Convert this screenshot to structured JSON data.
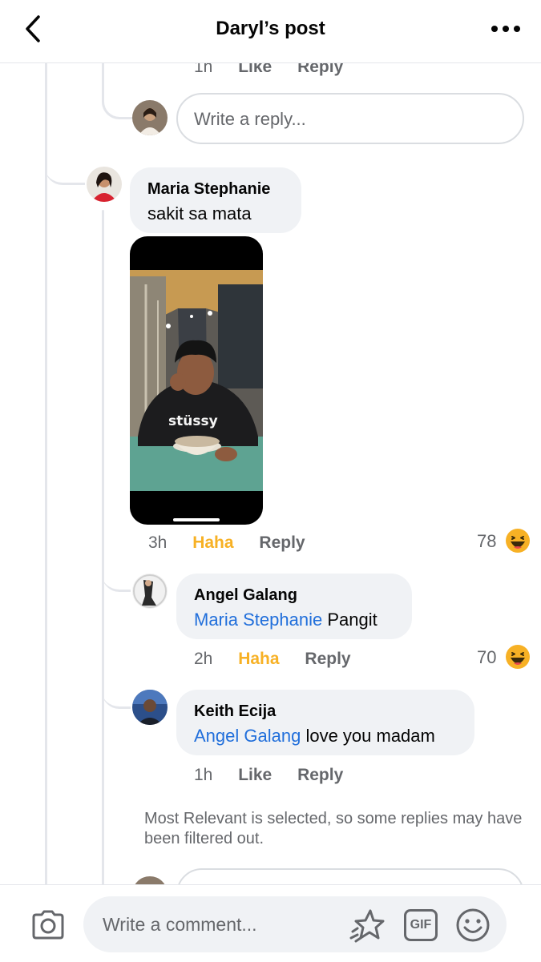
{
  "header": {
    "title": "Daryl’s post",
    "back_icon": "chevron-left-icon",
    "more_icon": "more-horizontal-icon"
  },
  "top_meta": {
    "time": "1h",
    "like": "Like",
    "reply": "Reply"
  },
  "reply_box": {
    "placeholder": "Write a reply..."
  },
  "comment": {
    "author": "Maria Stephanie",
    "text": "sakit sa mata",
    "time": "3h",
    "reaction_label": "Haha",
    "reply_label": "Reply",
    "reaction_count": "78",
    "reaction_icon": "haha-emoji-icon",
    "shirt_text": "stüssy"
  },
  "replies": [
    {
      "author": "Angel Galang",
      "mention": "Maria Stephanie",
      "text": " Pangit",
      "time": "2h",
      "reaction_label": "Haha",
      "reply_label": "Reply",
      "reaction_count": "70"
    },
    {
      "author": "Keith Ecija",
      "mention": "Angel Galang",
      "text": " love you madam",
      "time": "1h",
      "like_label": "Like",
      "reply_label": "Reply"
    }
  ],
  "filter_note": "Most Relevant is selected, so some replies may have been filtered out.",
  "footer": {
    "placeholder": "Write a comment...",
    "camera_icon": "camera-icon",
    "sticker_icon": "sticker-icon",
    "gif_label": "GIF",
    "emoji_icon": "smiley-icon"
  },
  "colors": {
    "link_blue": "#216fdb",
    "haha_yellow": "#f7b125",
    "bubble_gray": "#f0f2f5",
    "secondary_text": "#65676b"
  }
}
